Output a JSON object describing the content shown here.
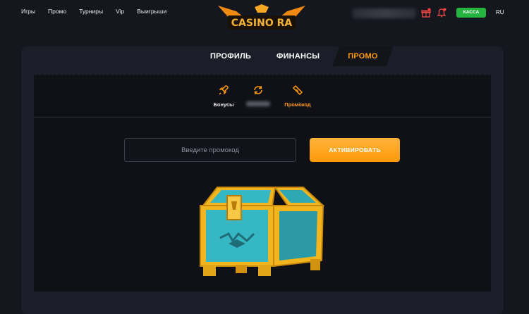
{
  "nav": {
    "items": [
      "Игры",
      "Промо",
      "Турниры",
      "Vip",
      "Выигрыши"
    ]
  },
  "logo": {
    "text": "CASINO RA"
  },
  "header": {
    "cashier_label": "КАССА",
    "language": "RU"
  },
  "tabs": [
    {
      "label": "ПРОФИЛЬ",
      "active": false
    },
    {
      "label": "ФИНАНСЫ",
      "active": false
    },
    {
      "label": "ПРОМО",
      "active": true
    }
  ],
  "subtabs": [
    {
      "label": "Бонусы",
      "icon": "rocket-icon",
      "active": false
    },
    {
      "label": "",
      "icon": "refresh-icon",
      "active": false
    },
    {
      "label": "Промокод",
      "icon": "ticket-icon",
      "active": true
    }
  ],
  "promo": {
    "placeholder": "Введите промокод",
    "activate_label": "АКТИВИРОВАТЬ"
  },
  "colors": {
    "accent": "#ff9a0a",
    "cashier": "#27b33f",
    "background": "#15171f",
    "card": "#1b1e28"
  }
}
